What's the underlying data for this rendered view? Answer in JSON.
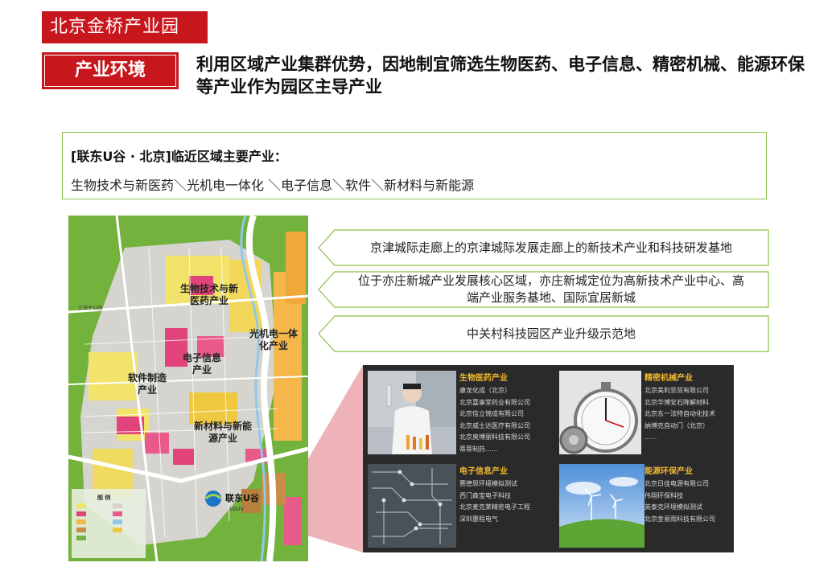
{
  "header": {
    "park_title": "北京金桥产业园",
    "section_label": "产业环境",
    "headline": "利用区域产业集群优势，因地制宜筛选生物医药、电子信息、精密机械、能源环保等产业作为园区主导产业"
  },
  "region": {
    "title": "[联东U谷 · 北京]临近区域主要产业：",
    "industries": "生物技术与新医药＼光机电一体化 ＼电子信息＼软件＼新材料与新能源"
  },
  "map": {
    "zones": {
      "biotech": "生物技术与新医药产业",
      "optomech": "光机电一体化产业",
      "electronic": "电子信息产业",
      "software": "软件制造产业",
      "materials": "新材料与新能源产业"
    },
    "logo_cn": "联东U谷",
    "logo_en": "LDUV",
    "road_label": "三海子公园",
    "legend_title": "图 例"
  },
  "callouts": [
    "京津城际走廊上的京津城际发展走廊上的新技术产业和科技研发基地",
    "位于亦庄新城产业发展核心区域，亦庄新城定位为高新技术产业中心、高端产业服务基地、国际宜居新城",
    "中关村科技园区产业升级示范地"
  ],
  "industries": [
    {
      "category": "生物医药产业",
      "companies": [
        "康龙化成（北京）",
        "北京嘉事堂药业有限公司",
        "北京信立锦成有限公司",
        "北京威士达医疗有限公司",
        "北京奥博丽科技有限公司",
        "蒂蒂制药......"
      ]
    },
    {
      "category": "精密机械产业",
      "companies": [
        "北京美利坚贸有限公司",
        "北京华博安石降解材料",
        "北京东一法特自动化技术",
        "纳博克自动门（北京）",
        "......"
      ]
    },
    {
      "category": "电子信息产业",
      "companies": [
        "赛德思环境模拟测试",
        "西门森宝电子科技",
        "北京麦克莱精密电子工程",
        "深圳惠程电气"
      ]
    },
    {
      "category": "能源环保产业",
      "companies": [
        "北京日佳电源有限公司",
        "伟翔环保科技",
        "英泰克环境模拟测试",
        "北京金易雨科技有限公司"
      ]
    }
  ],
  "colors": {
    "brand_red": "#c8161d",
    "green_border": "#8cc04a",
    "gold": "#f0b830"
  }
}
